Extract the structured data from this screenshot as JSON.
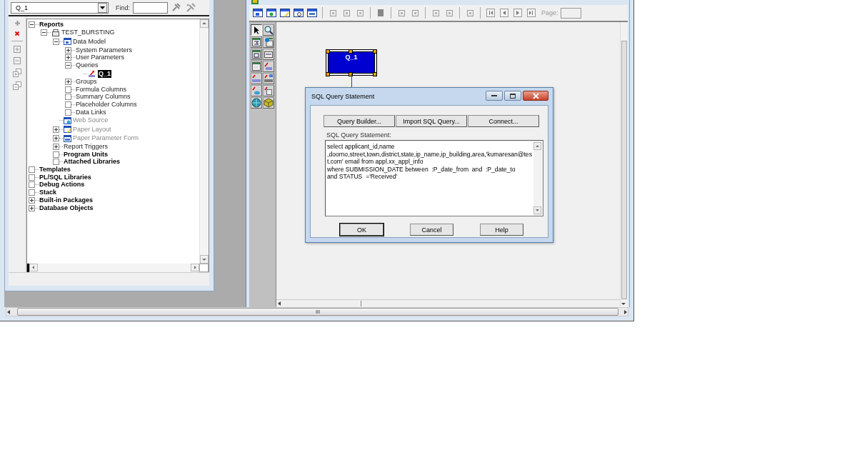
{
  "navigator": {
    "object_selector": {
      "value": "Q_1"
    },
    "find": {
      "label": "Find:"
    }
  },
  "tree": [
    {
      "label": "Reports",
      "kind": "category",
      "expanded": true,
      "disabled": false,
      "selected": false,
      "children": [
        {
          "label": "TEST_BURSTING",
          "kind": "report",
          "expanded": true,
          "disabled": false,
          "selected": false,
          "children": [
            {
              "label": "Data Model",
              "kind": "data-model",
              "expanded": true,
              "disabled": false,
              "selected": false,
              "children": [
                {
                  "label": "System Parameters",
                  "kind": "group",
                  "expanded": false,
                  "disabled": false,
                  "selected": false
                },
                {
                  "label": "User Parameters",
                  "kind": "group",
                  "expanded": false,
                  "disabled": false,
                  "selected": false
                },
                {
                  "label": "Queries",
                  "kind": "group",
                  "expanded": true,
                  "disabled": false,
                  "selected": false,
                  "children": [
                    {
                      "label": "Q_1",
                      "kind": "query",
                      "disabled": false,
                      "selected": true
                    }
                  ]
                },
                {
                  "label": "Groups",
                  "kind": "group",
                  "expanded": false,
                  "disabled": false,
                  "selected": false
                },
                {
                  "label": "Formula Columns",
                  "kind": "group",
                  "disabled": false,
                  "selected": false
                },
                {
                  "label": "Summary Columns",
                  "kind": "group",
                  "disabled": false,
                  "selected": false
                },
                {
                  "label": "Placeholder Columns",
                  "kind": "group",
                  "disabled": false,
                  "selected": false
                },
                {
                  "label": "Data Links",
                  "kind": "group",
                  "disabled": false,
                  "selected": false
                }
              ]
            },
            {
              "label": "Web Source",
              "kind": "web-source",
              "disabled": true,
              "selected": false
            },
            {
              "label": "Paper Layout",
              "kind": "paper-layout",
              "expanded": false,
              "disabled": true,
              "selected": false
            },
            {
              "label": "Paper Parameter Form",
              "kind": "parameter-form",
              "expanded": false,
              "disabled": true,
              "selected": false
            },
            {
              "label": "Report Triggers",
              "kind": "group",
              "expanded": false,
              "disabled": false,
              "selected": false
            },
            {
              "label": "Program Units",
              "kind": "category",
              "disabled": false,
              "selected": false
            },
            {
              "label": "Attached Libraries",
              "kind": "category",
              "disabled": false,
              "selected": false
            }
          ]
        }
      ]
    },
    {
      "label": "Templates",
      "kind": "category",
      "disabled": false,
      "selected": false
    },
    {
      "label": "PL/SQL Libraries",
      "kind": "category",
      "disabled": false,
      "selected": false
    },
    {
      "label": "Debug Actions",
      "kind": "category",
      "disabled": false,
      "selected": false
    },
    {
      "label": "Stack",
      "kind": "category",
      "disabled": false,
      "selected": false
    },
    {
      "label": "Built-in Packages",
      "kind": "category",
      "expanded": false,
      "disabled": false,
      "selected": false
    },
    {
      "label": "Database Objects",
      "kind": "category",
      "expanded": false,
      "disabled": false,
      "selected": false
    }
  ],
  "editor": {
    "toolbar": {
      "page_label": "Page:"
    },
    "canvas": {
      "nodes": [
        {
          "label": "Q_1",
          "selected": true
        }
      ]
    }
  },
  "dialog": {
    "title": "SQL Query Statement",
    "buttons": [
      {
        "label": "Query Builder..."
      },
      {
        "label": "Import SQL Query..."
      },
      {
        "label": "Connect..."
      }
    ],
    "statement_label": "SQL Query Statement:",
    "statement": "select applicant_id,name\n,doorno,street,town,district,state,ip_name,ip_building,area,'kumaresan@test.com' email from appl.xx_appl_info\nwhere SUBMISSION_DATE between  :P_date_from  and  :P_date_to\nand STATUS  ='Received'",
    "actions": [
      {
        "label": "OK",
        "default": true
      },
      {
        "label": "Cancel",
        "default": false
      },
      {
        "label": "Help",
        "default": false
      }
    ]
  }
}
